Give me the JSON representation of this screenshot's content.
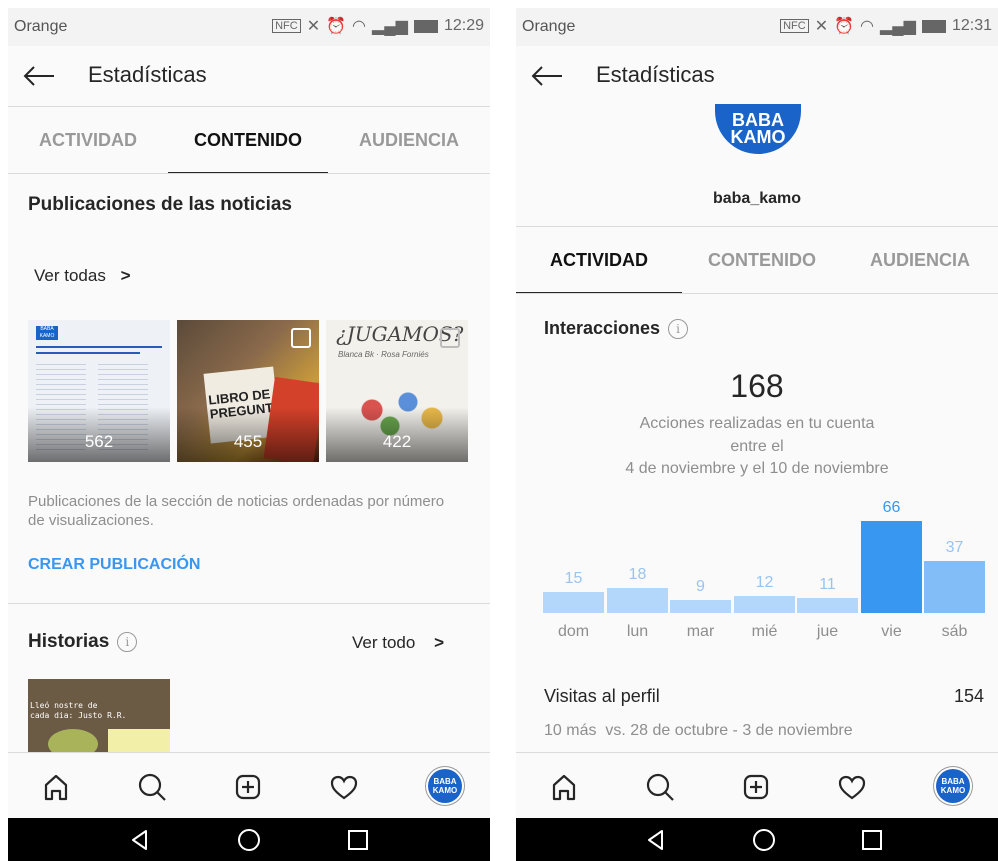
{
  "status": {
    "carrier": "Orange",
    "left_time": "12:29",
    "right_time": "12:31"
  },
  "left": {
    "title": "Estadísticas",
    "tabs": [
      "ACTIVIDAD",
      "CONTENIDO",
      "AUDIENCIA"
    ],
    "active_tab": "CONTENIDO",
    "posts_section": {
      "title": "Publicaciones de las noticias",
      "see_all": "Ver todas",
      "posts": [
        {
          "count": "562",
          "header": "BABA KAMO",
          "text_heading": "Participants seguint la... (text)"
        },
        {
          "count": "455",
          "book_text": "LIBRO DE PREGUNT"
        },
        {
          "count": "422",
          "handwriting": "¿JUGAMOS?",
          "authors": "Blanca Bk · Rosa Forniés"
        }
      ],
      "description": "Publicaciones de la sección de noticias ordenadas por número de visualizaciones.",
      "cta": "CREAR PUBLICACIÓN"
    },
    "stories_section": {
      "title": "Historias",
      "see_all": "Ver todo",
      "story_text": "Lleó nostre de\ncada dia: Justo R.R."
    }
  },
  "right": {
    "title": "Estadísticas",
    "profile": {
      "avatar_top": "BABA",
      "avatar_bottom": "KAMO",
      "username": "baba_kamo"
    },
    "tabs": [
      "ACTIVIDAD",
      "CONTENIDO",
      "AUDIENCIA"
    ],
    "active_tab": "ACTIVIDAD",
    "interactions": {
      "title": "Interacciones",
      "total": "168",
      "line1": "Acciones realizadas en tu cuenta",
      "line2": "entre el",
      "line3": "4 de noviembre y el 10 de noviembre"
    },
    "chart_data": {
      "type": "bar",
      "categories": [
        "dom",
        "lun",
        "mar",
        "mié",
        "jue",
        "vie",
        "sáb"
      ],
      "values": [
        15,
        18,
        9,
        12,
        11,
        66,
        37
      ],
      "highlight_index": 5,
      "colors": {
        "normal": "#b3d6fb",
        "highlight": "#3897f0",
        "alt": "#82bdf7",
        "label_normal": "#9ac4f0",
        "label_highlight": "#3897f0"
      }
    },
    "profile_visits": {
      "label": "Visitas al perfil",
      "value": "154",
      "comparison": "10 más  vs. 28 de octubre - 3 de noviembre"
    }
  },
  "nav": {
    "items": [
      "home-icon",
      "search-icon",
      "new-post-icon",
      "activity-heart-icon",
      "profile-avatar"
    ],
    "avatar_top": "BABA",
    "avatar_bottom": "KAMO"
  },
  "system": {
    "buttons": [
      "back-triangle",
      "home-circle",
      "recents-square"
    ]
  }
}
